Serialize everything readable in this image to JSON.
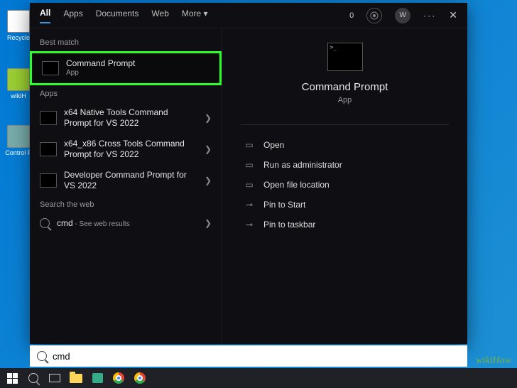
{
  "desktop": {
    "icons": [
      "Recycle",
      "wikiH",
      "Control P"
    ]
  },
  "tabs": {
    "items": [
      "All",
      "Apps",
      "Documents",
      "Web",
      "More"
    ],
    "active": 0,
    "counter": "0",
    "user_initial": "W"
  },
  "left": {
    "best_label": "Best match",
    "best": {
      "title": "Command Prompt",
      "sub": "App"
    },
    "apps_label": "Apps",
    "apps": [
      {
        "title": "x64 Native Tools Command Prompt for VS 2022"
      },
      {
        "title": "x64_x86 Cross Tools Command Prompt for VS 2022"
      },
      {
        "title": "Developer Command Prompt for VS 2022"
      }
    ],
    "web_label": "Search the web",
    "web": {
      "query": "cmd",
      "suffix": " - See web results"
    }
  },
  "right": {
    "title": "Command Prompt",
    "sub": "App",
    "actions": [
      "Open",
      "Run as administrator",
      "Open file location",
      "Pin to Start",
      "Pin to taskbar"
    ]
  },
  "search": {
    "value": "cmd"
  },
  "watermark": "wikiHow"
}
